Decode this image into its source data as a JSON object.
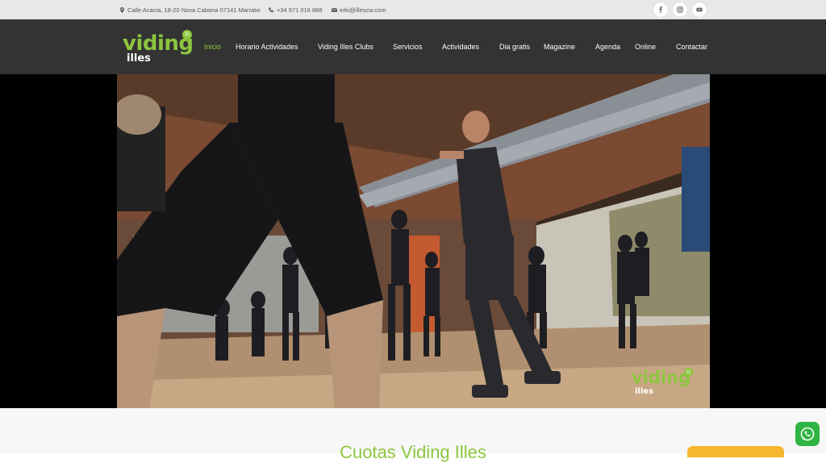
{
  "topbar": {
    "address": "Calle Acacia, 18-20 Nova Cabana 07141 Marratxi",
    "phone": "+34 971 016 888",
    "email": "info@illescw.com",
    "social": [
      "facebook-icon",
      "instagram-icon",
      "youtube-icon"
    ]
  },
  "logo": {
    "brand": "viding",
    "sub": "illes",
    "badge": "31"
  },
  "nav": {
    "items": [
      {
        "label": "Inicio",
        "active": true
      },
      {
        "label": "Horario Actividades"
      },
      {
        "label": "Viding Illes Clubs"
      },
      {
        "label": "Servicios"
      },
      {
        "label": "Actividades"
      },
      {
        "label": "Dia gratis"
      },
      {
        "label": "Magazine"
      },
      {
        "label": "Agenda"
      },
      {
        "label": "Online"
      },
      {
        "label": "Contactar"
      }
    ]
  },
  "hero": {
    "watermark": {
      "brand": "viding",
      "sub": "illes",
      "badge": "31"
    }
  },
  "section": {
    "title": "Cuotas Viding Illes"
  },
  "colors": {
    "accent": "#8dc63f",
    "nav_bg": "#333333",
    "topbar_bg": "#e8e8e8",
    "whatsapp": "#2fb543",
    "cta": "#f5b82e"
  }
}
